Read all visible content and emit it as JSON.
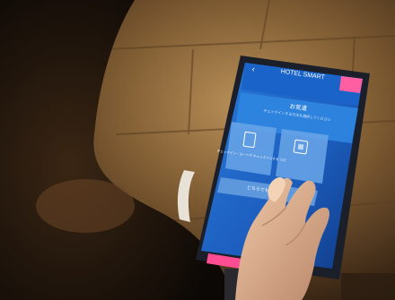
{
  "photo": {
    "description_free": true,
    "tablet": {
      "brand_text": "HOTEL SMART",
      "back_glyph": "‹",
      "header_heading": "お気遣",
      "header_subtitle": "チェックインする方法を選択してください",
      "option_left_label": "チェックイン・コードで\nチェックインする\nうだ",
      "option_right_label": "",
      "bottom_button_label": "どちらでもないカ…",
      "corner_badge_label": ""
    }
  }
}
